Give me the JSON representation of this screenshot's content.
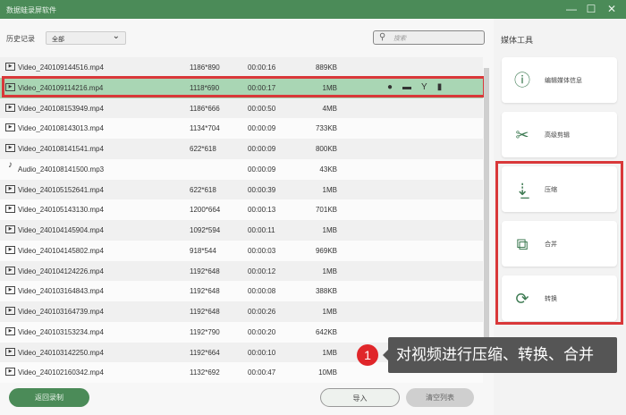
{
  "app_title": "数据蛙录屏软件",
  "window_controls": {
    "minimize": "—",
    "maximize": "☐",
    "close": "✕"
  },
  "filter": {
    "label": "历史记录",
    "value": "全部"
  },
  "search": {
    "placeholder": "搜索"
  },
  "rows": [
    {
      "type": "video",
      "name": "Video_240109144516.mp4",
      "res": "1186*890",
      "dur": "00:00:16",
      "size": "889KB"
    },
    {
      "type": "video",
      "name": "Video_240109114216.mp4",
      "res": "1118*690",
      "dur": "00:00:17",
      "size": "1MB",
      "selected": true
    },
    {
      "type": "video",
      "name": "Video_240108153949.mp4",
      "res": "1186*666",
      "dur": "00:00:50",
      "size": "4MB"
    },
    {
      "type": "video",
      "name": "Video_240108143013.mp4",
      "res": "1134*704",
      "dur": "00:00:09",
      "size": "733KB"
    },
    {
      "type": "video",
      "name": "Video_240108141541.mp4",
      "res": "622*618",
      "dur": "00:00:09",
      "size": "800KB"
    },
    {
      "type": "audio",
      "name": "Audio_240108141500.mp3",
      "res": "",
      "dur": "00:00:09",
      "size": "43KB"
    },
    {
      "type": "video",
      "name": "Video_240105152641.mp4",
      "res": "622*618",
      "dur": "00:00:39",
      "size": "1MB"
    },
    {
      "type": "video",
      "name": "Video_240105143130.mp4",
      "res": "1200*664",
      "dur": "00:00:13",
      "size": "701KB"
    },
    {
      "type": "video",
      "name": "Video_240104145904.mp4",
      "res": "1092*594",
      "dur": "00:00:11",
      "size": "1MB"
    },
    {
      "type": "video",
      "name": "Video_240104145802.mp4",
      "res": "918*544",
      "dur": "00:00:03",
      "size": "969KB"
    },
    {
      "type": "video",
      "name": "Video_240104124226.mp4",
      "res": "1192*648",
      "dur": "00:00:12",
      "size": "1MB"
    },
    {
      "type": "video",
      "name": "Video_240103164843.mp4",
      "res": "1192*648",
      "dur": "00:00:08",
      "size": "388KB"
    },
    {
      "type": "video",
      "name": "Video_240103164739.mp4",
      "res": "1192*648",
      "dur": "00:00:26",
      "size": "1MB"
    },
    {
      "type": "video",
      "name": "Video_240103153234.mp4",
      "res": "1192*790",
      "dur": "00:00:20",
      "size": "642KB"
    },
    {
      "type": "video",
      "name": "Video_240103142250.mp4",
      "res": "1192*664",
      "dur": "00:00:10",
      "size": "1MB"
    },
    {
      "type": "video",
      "name": "Video_240102160342.mp4",
      "res": "1132*692",
      "dur": "00:00:47",
      "size": "10MB"
    }
  ],
  "side": {
    "title": "媒体工具",
    "tools": [
      {
        "label": "编辑媒体信息",
        "icon": "info-icon"
      },
      {
        "label": "高级剪辑",
        "icon": "scissors-icon"
      },
      {
        "label": "压缩",
        "icon": "compress-icon"
      },
      {
        "label": "合并",
        "icon": "merge-icon"
      },
      {
        "label": "转换",
        "icon": "convert-icon"
      }
    ]
  },
  "buttons": {
    "back": "返回录制",
    "import": "导入",
    "clear": "清空列表"
  },
  "annotation": {
    "number": "1",
    "text": "对视频进行压缩、转换、合并"
  },
  "colors": {
    "brand": "#4b8b58",
    "highlight": "#d9383a",
    "selected_row": "#a9d6b4"
  }
}
